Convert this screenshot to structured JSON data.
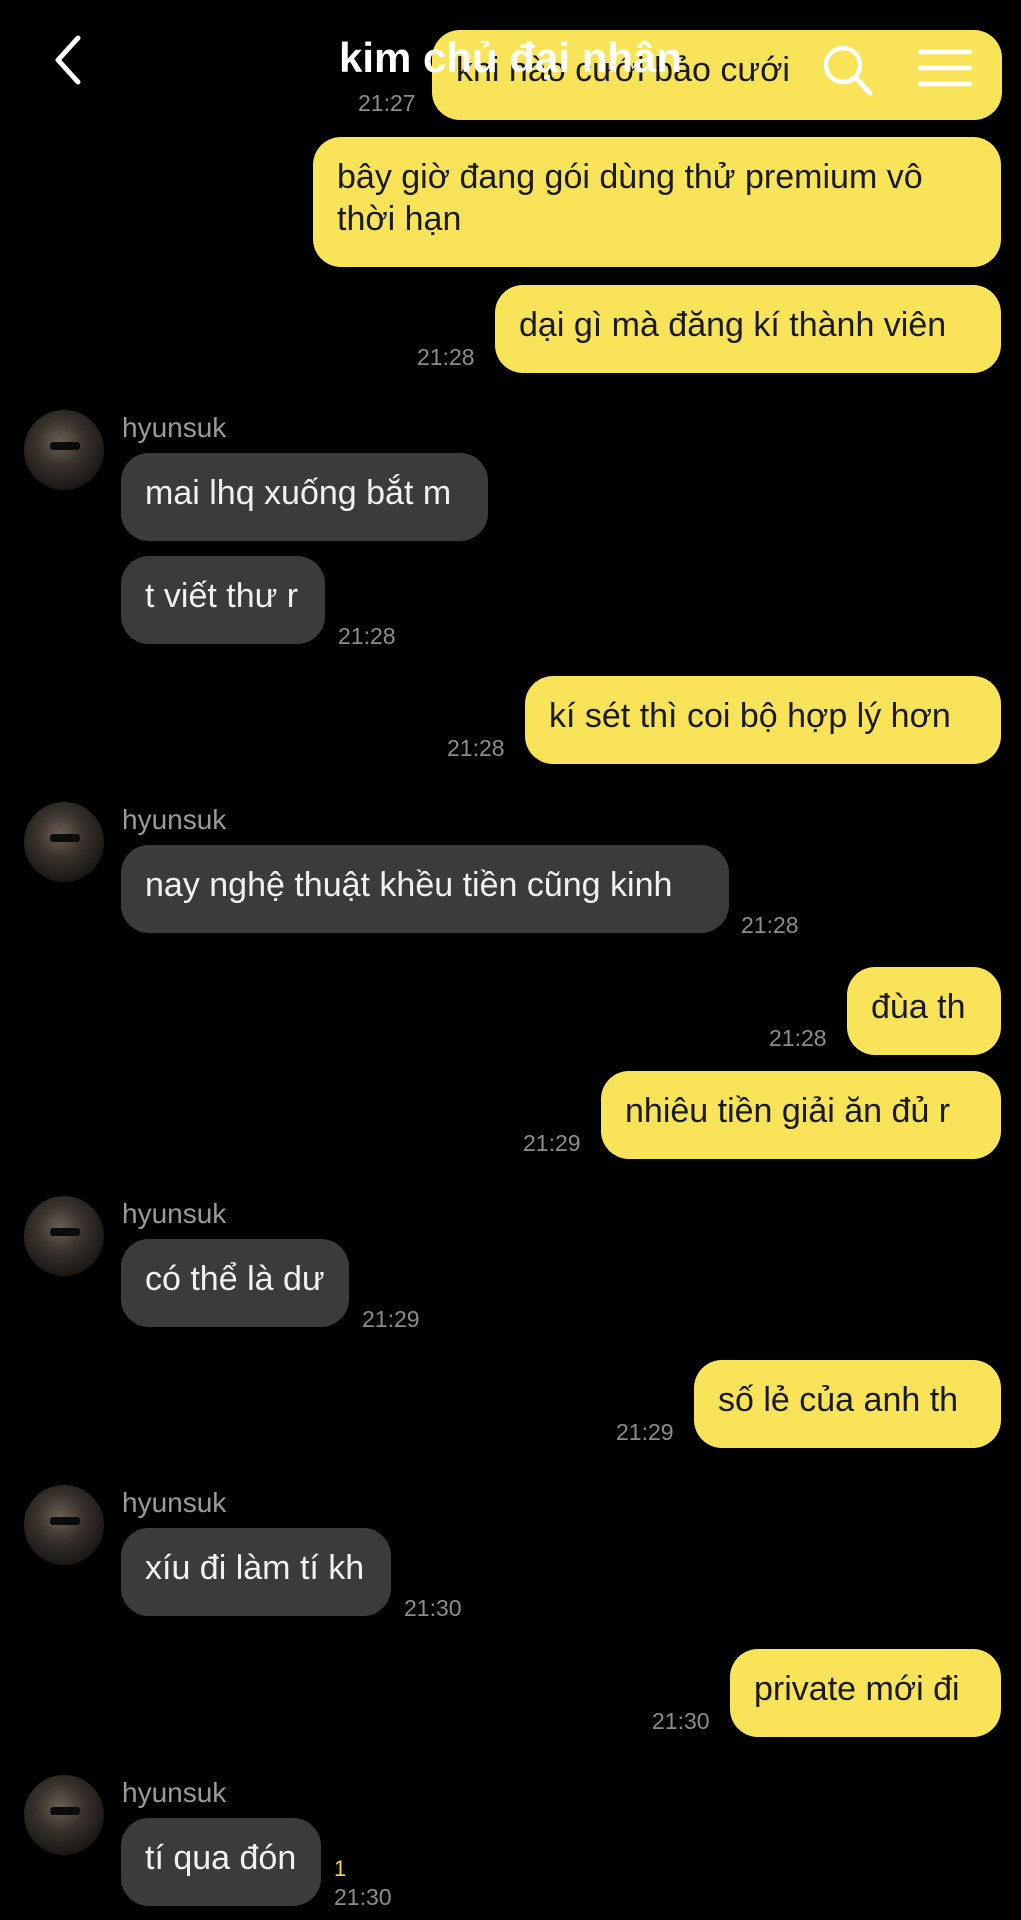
{
  "header": {
    "title": "kim chủ đại nhân",
    "back_icon": "chevron-left-icon",
    "search_icon": "search-icon",
    "menu_icon": "hamburger-menu-icon"
  },
  "colors": {
    "my_bubble": "#f9e459",
    "their_bubble": "#3b3b3d",
    "background": "#000000"
  },
  "messages": [
    {
      "text": "khi nào cưới bảo cưới",
      "time": "21:27"
    },
    {
      "text": "bây giờ đang gói dùng thử premium vô thời hạn"
    },
    {
      "text": "dại gì mà đăng kí thành viên",
      "time": "21:28"
    },
    {
      "sender": "hyunsuk",
      "text": "mai lhq xuống bắt m"
    },
    {
      "text": "t viết thư r",
      "time": "21:28"
    },
    {
      "text": "kí sét thì coi bộ hợp lý hơn",
      "time": "21:28"
    },
    {
      "sender": "hyunsuk",
      "text": "nay nghệ thuật khều tiền cũng kinh",
      "time": "21:28"
    },
    {
      "text": "đùa th",
      "time": "21:28"
    },
    {
      "text": "nhiêu tiền giải ăn đủ r",
      "time": "21:29"
    },
    {
      "sender": "hyunsuk",
      "text": "có thể là dư",
      "time": "21:29"
    },
    {
      "text": "số lẻ của anh th",
      "time": "21:29"
    },
    {
      "sender": "hyunsuk",
      "text": "xíu đi làm tí kh",
      "time": "21:30"
    },
    {
      "text": "private mới đi",
      "time": "21:30"
    },
    {
      "sender": "hyunsuk",
      "text": "tí qua đón",
      "time": "21:30",
      "unread": "1"
    }
  ]
}
